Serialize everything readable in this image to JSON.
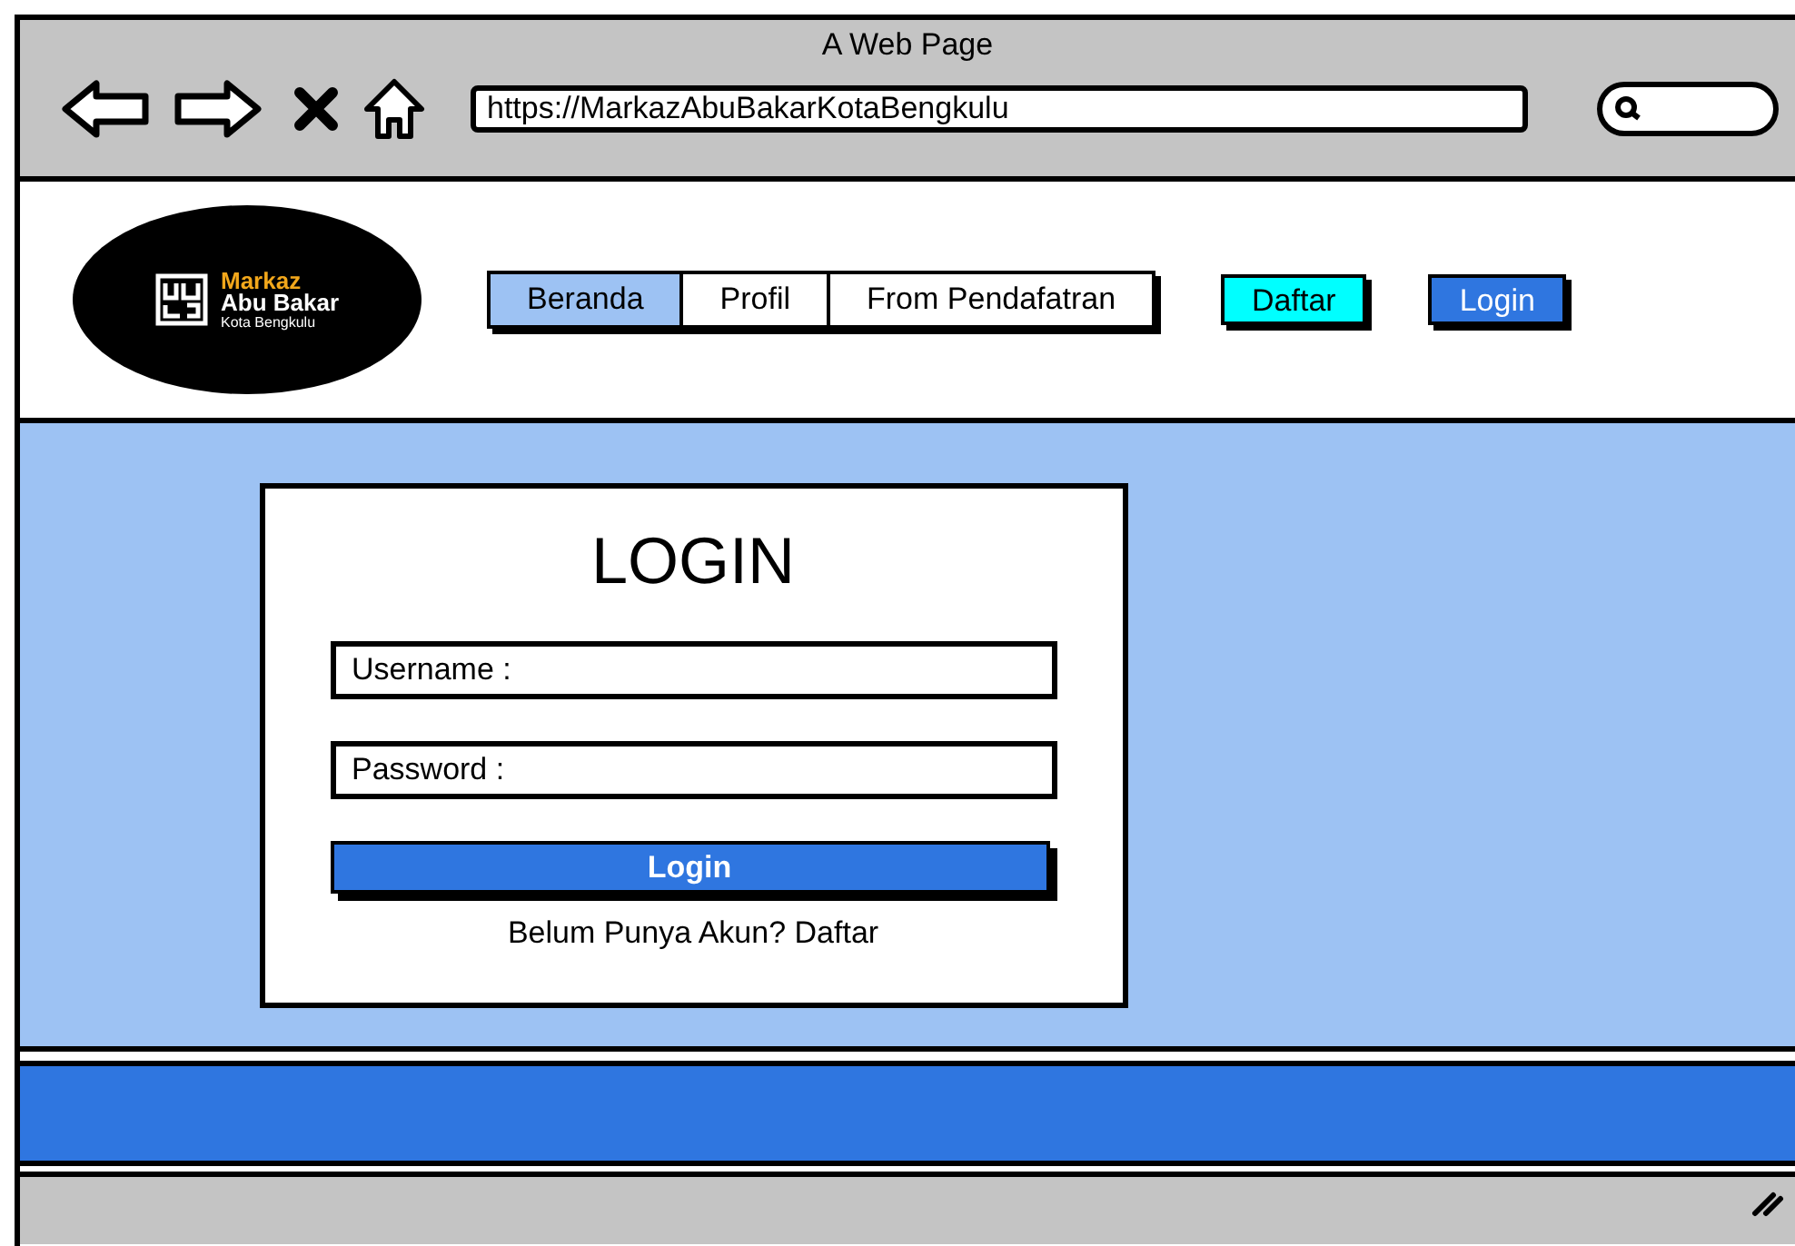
{
  "window": {
    "title": "A Web Page"
  },
  "browser": {
    "url": "https://MarkazAbuBakarKotaBengkulu"
  },
  "logo": {
    "line_1": "Markaz",
    "line_2": "Abu Bakar",
    "line_3": "Kota Bengkulu"
  },
  "nav": [
    {
      "label": "Beranda",
      "selected": true
    },
    {
      "label": "Profil",
      "selected": false
    },
    {
      "label": "From Pendafatran",
      "selected": false
    }
  ],
  "header_buttons": [
    {
      "label": "Daftar",
      "kind": "register"
    },
    {
      "label": "Login",
      "kind": "login"
    }
  ],
  "login_form": {
    "title": "LOGIN",
    "fields": [
      {
        "placeholder": "Username :"
      },
      {
        "placeholder": "Password :"
      }
    ],
    "submit": "Login",
    "footer_text": "Belum Punya Akun? Daftar"
  }
}
